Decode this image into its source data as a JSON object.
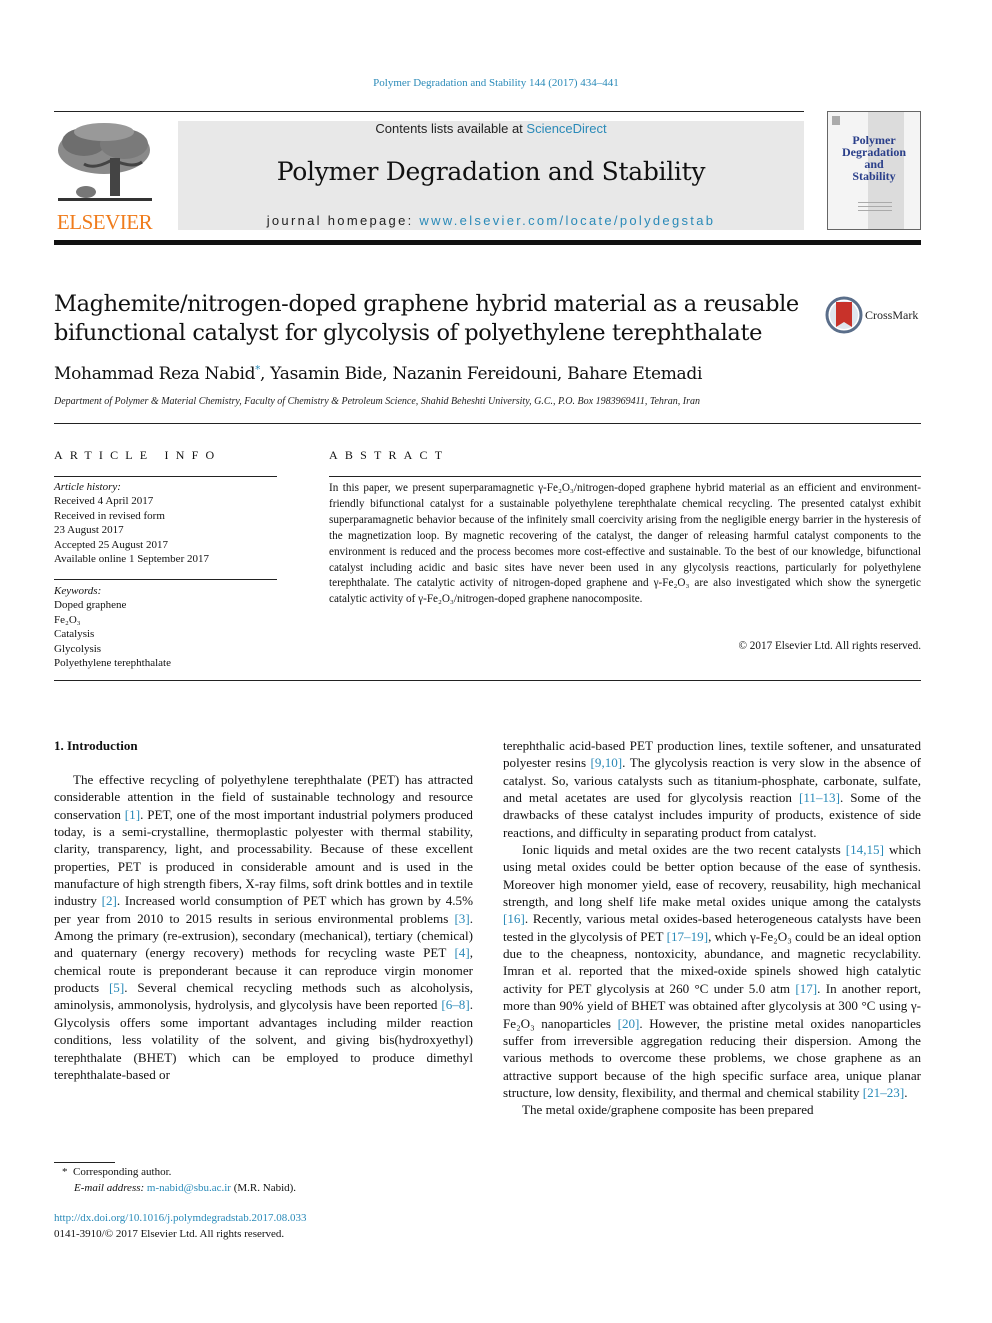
{
  "running_head": "Polymer Degradation and Stability 144 (2017) 434–441",
  "masthead": {
    "publisher_logo_text": "ELSEVIER",
    "contents_prefix": "Contents lists available at ",
    "contents_link": "ScienceDirect",
    "journal_title": "Polymer Degradation and Stability",
    "homepage_prefix": "journal homepage: ",
    "homepage_link": "www.elsevier.com/locate/polydegstab",
    "cover_title_lines": [
      "Polymer",
      "Degradation",
      "and",
      "Stability"
    ]
  },
  "article": {
    "title_line1": "Maghemite/nitrogen-doped graphene hybrid material as a reusable",
    "title_line2": "bifunctional catalyst for glycolysis of polyethylene terephthalate",
    "crossmark_label": "CrossMark",
    "authors": {
      "first": "Mohammad Reza Nabid",
      "first_mark": "*",
      "rest": ", Yasamin Bide, Nazanin Fereidouni, Bahare Etemadi"
    },
    "affiliation": "Department of Polymer & Material Chemistry, Faculty of Chemistry & Petroleum Science, Shahid Beheshti University, G.C., P.O. Box 1983969411, Tehran, Iran"
  },
  "article_info": {
    "heading": "ARTICLE INFO",
    "history_label": "Article history:",
    "history": [
      "Received 4 April 2017",
      "Received in revised form",
      "23 August 2017",
      "Accepted 25 August 2017",
      "Available online 1 September 2017"
    ],
    "keywords_label": "Keywords:",
    "keywords": [
      "Doped graphene",
      "Fe₂O₃",
      "Catalysis",
      "Glycolysis",
      "Polyethylene terephthalate"
    ]
  },
  "abstract": {
    "heading": "ABSTRACT",
    "text": "In this paper, we present superparamagnetic γ-Fe₂O₃/nitrogen-doped graphene hybrid material as an efficient and environment-friendly bifunctional catalyst for a sustainable polyethylene terephthalate chemical recycling. The presented catalyst exhibit superparamagnetic behavior because of the infinitely small coercivity arising from the negligible energy barrier in the hysteresis of the magnetization loop. By magnetic recovering of the catalyst, the danger of releasing harmful catalyst components to the environment is reduced and the process becomes more cost-effective and sustainable. To the best of our knowledge, bifunctional catalyst including acidic and basic sites have never been used in any glycolysis reactions, particularly for polyethylene terephthalate. The catalytic activity of nitrogen-doped graphene and γ-Fe₂O₃ are also investigated which show the synergetic catalytic activity of γ-Fe₂O₃/nitrogen-doped graphene nanocomposite.",
    "copyright": "© 2017 Elsevier Ltd. All rights reserved."
  },
  "introduction": {
    "heading": "1.  Introduction",
    "left_column": [
      [
        {
          "t": "The effective recycling of polyethylene terephthalate (PET) has attracted considerable attention in the field of sustainable technology and resource conservation "
        },
        {
          "ref": "[1]"
        },
        {
          "t": ". PET, one of the most important industrial polymers produced today, is a semi-crystalline, thermoplastic polyester with thermal stability, clarity, transparency, light, and processability. Because of these excellent properties, PET is produced in considerable amount and is used in the manufacture of high strength fibers, X-ray films, soft drink bottles and in textile industry "
        },
        {
          "ref": "[2]"
        },
        {
          "t": ". Increased world consumption of PET which has grown by 4.5% per year from 2010 to 2015 results in serious environmental problems "
        },
        {
          "ref": "[3]"
        },
        {
          "t": ". Among the primary (re-extrusion), secondary (mechanical), tertiary (chemical) and quaternary (energy recovery) methods for recycling waste PET "
        },
        {
          "ref": "[4]"
        },
        {
          "t": ", chemical route is preponderant because it can reproduce virgin monomer products "
        },
        {
          "ref": "[5]"
        },
        {
          "t": ". Several chemical recycling methods such as alcoholysis, aminolysis, ammonolysis, hydrolysis, and glycolysis have been reported "
        },
        {
          "ref": "[6–8]"
        },
        {
          "t": ". Glycolysis offers some important advantages including milder reaction conditions, less volatility of the solvent, and giving bis(hydroxyethyl) terephthalate (BHET) which can be employed to produce dimethyl terephthalate-based or"
        }
      ]
    ],
    "right_column": [
      [
        {
          "t": "terephthalic acid-based PET production lines, textile softener, and unsaturated polyester resins "
        },
        {
          "ref": "[9,10]"
        },
        {
          "t": ". The glycolysis reaction is very slow in the absence of catalyst. So, various catalysts such as titanium-phosphate, carbonate, sulfate, and metal acetates are used for glycolysis reaction "
        },
        {
          "ref": "[11–13]"
        },
        {
          "t": ". Some of the drawbacks of these catalyst includes impurity of products, existence of side reactions, and difficulty in separating product from catalyst."
        }
      ],
      [
        {
          "t": "Ionic liquids and metal oxides are the two recent catalysts "
        },
        {
          "ref": "[14,15]"
        },
        {
          "t": " which using metal oxides could be better option because of the ease of synthesis. Moreover high monomer yield, ease of recovery, reusability, high mechanical strength, and long shelf life make metal oxides unique among the catalysts "
        },
        {
          "ref": "[16]"
        },
        {
          "t": ". Recently, various metal oxides-based heterogeneous catalysts have been tested in the glycolysis of PET "
        },
        {
          "ref": "[17–19]"
        },
        {
          "t": ", which γ-Fe₂O₃ could be an ideal option due to the cheapness, nontoxicity, abundance, and magnetic recyclability. Imran et al. reported that the mixed-oxide spinels showed high catalytic activity for PET glycolysis at 260 °C under 5.0 atm "
        },
        {
          "ref": "[17]"
        },
        {
          "t": ". In another report, more than 90% yield of BHET was obtained after glycolysis at 300 °C using γ-Fe₂O₃ nanoparticles "
        },
        {
          "ref": "[20]"
        },
        {
          "t": ". However, the pristine metal oxides nanoparticles suffer from irreversible aggregation reducing their dispersion. Among the various methods to overcome these problems, we chose graphene as an attractive support because of the high specific surface area, unique planar structure, low density, flexibility, and thermal and chemical stability "
        },
        {
          "ref": "[21–23]"
        },
        {
          "t": "."
        }
      ],
      [
        {
          "t": "The metal oxide/graphene composite has been prepared"
        }
      ]
    ]
  },
  "footnotes": {
    "corresponding_mark": "*",
    "corresponding_text": "Corresponding author.",
    "email_label": "E-mail address: ",
    "email": "m-nabid@sbu.ac.ir",
    "email_suffix": " (M.R. Nabid).",
    "doi": "http://dx.doi.org/10.1016/j.polymdegradstab.2017.08.033",
    "issn_line": "0141-3910/© 2017 Elsevier Ltd. All rights reserved."
  },
  "colors": {
    "link": "#2a8ab8",
    "elsevier_orange": "#f07c1c",
    "masthead_gray": "#e8e8e8",
    "cover_title": "#2a3f8a",
    "crossmark_red": "#c8322a"
  }
}
